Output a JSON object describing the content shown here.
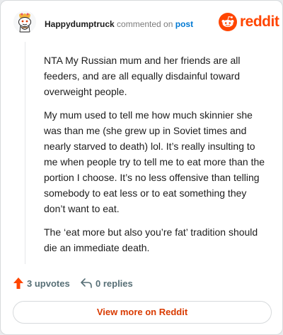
{
  "header": {
    "username": "Happydumptruck",
    "action_text": "commented on",
    "post_link": "post",
    "brand_word": "reddit",
    "avatar_icon": "snoo-avatar-icon",
    "brand_icon": "reddit-logo-icon",
    "brand_color": "#ff4500"
  },
  "comment": {
    "paragraphs": [
      "NTA My Russian mum and her friends are all feeders, and are all equally disdainful toward overweight people.",
      "My mum used to tell me how much skinnier she was than me (she grew up in Soviet times and nearly starved to death) lol. It’s really insulting to me when people try to tell me to eat more than the portion I choose. It’s no less offensive than telling somebody to eat less or to eat something they don’t want to eat.",
      "The ‘eat more but also you’re fat’ tradition should die an immediate death."
    ]
  },
  "footer": {
    "upvotes": "3 upvotes",
    "replies": "0 replies",
    "upvote_icon": "upvote-arrow-icon",
    "reply_icon": "reply-arrow-icon",
    "upvote_color": "#ff4500"
  },
  "view_more": "View more on Reddit"
}
